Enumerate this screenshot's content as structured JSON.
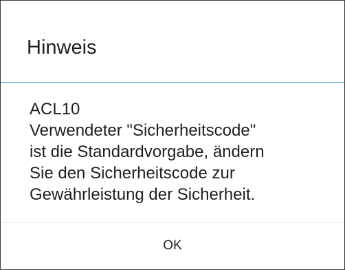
{
  "dialog": {
    "title": "Hinweis",
    "body_lines": [
      "ACL10",
      "Verwendeter \"Sicherheitscode\"",
      "ist die Standardvorgabe, ändern",
      "Sie den Sicherheitscode zur",
      "Gewährleistung der Sicherheit."
    ],
    "ok_label": "OK"
  },
  "colors": {
    "accent_divider": "#4aa6d6",
    "border": "#3a3a3a",
    "text": "#1f1f1f"
  }
}
